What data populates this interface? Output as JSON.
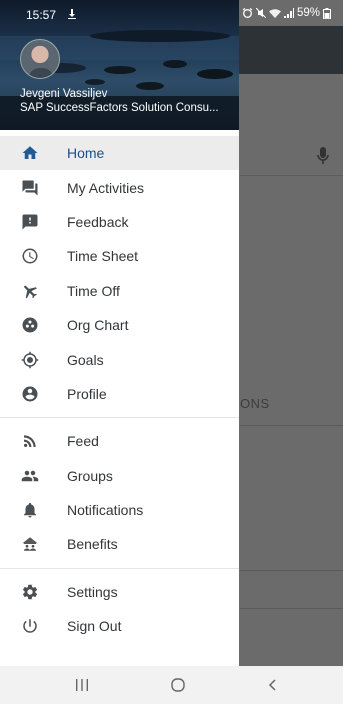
{
  "status": {
    "time": "15:57",
    "battery": "59%"
  },
  "user": {
    "name": "Jevgeni Vassiljev",
    "title": "SAP SuccessFactors Solution Consu..."
  },
  "menu": {
    "main": [
      {
        "label": "Home",
        "icon": "home-icon",
        "active": true
      },
      {
        "label": "My Activities",
        "icon": "activities-icon"
      },
      {
        "label": "Feedback",
        "icon": "feedback-icon"
      },
      {
        "label": "Time Sheet",
        "icon": "clock-icon"
      },
      {
        "label": "Time Off",
        "icon": "airplane-icon"
      },
      {
        "label": "Org Chart",
        "icon": "org-chart-icon"
      },
      {
        "label": "Goals",
        "icon": "target-icon"
      },
      {
        "label": "Profile",
        "icon": "profile-icon"
      }
    ],
    "social": [
      {
        "label": "Feed",
        "icon": "feed-icon"
      },
      {
        "label": "Groups",
        "icon": "groups-icon"
      },
      {
        "label": "Notifications",
        "icon": "bell-icon"
      },
      {
        "label": "Benefits",
        "icon": "benefits-icon"
      }
    ],
    "system": [
      {
        "label": "Settings",
        "icon": "gear-icon"
      },
      {
        "label": "Sign Out",
        "icon": "power-icon"
      }
    ]
  },
  "background": {
    "section_text": "ONS"
  }
}
